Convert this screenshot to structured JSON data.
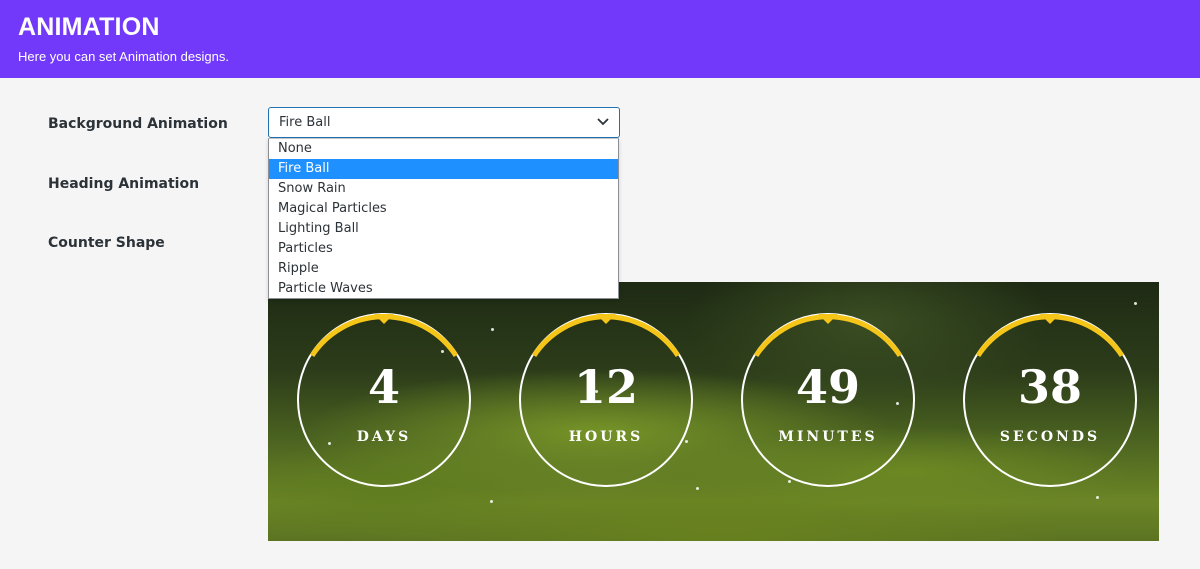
{
  "header": {
    "title": "ANIMATION",
    "subtitle": "Here you can set Animation designs."
  },
  "fields": {
    "background_animation_label": "Background Animation",
    "heading_animation_label": "Heading Animation",
    "counter_shape_label": "Counter Shape"
  },
  "select": {
    "value": "Fire Ball",
    "options": [
      "None",
      "Fire Ball",
      "Snow Rain",
      "Magical Particles",
      "Lighting Ball",
      "Particles",
      "Ripple",
      "Particle Waves"
    ],
    "selected_option": "Fire Ball"
  },
  "countdown": {
    "accent_color": "#f5c518",
    "items": [
      {
        "value": "4",
        "unit": "DAYS"
      },
      {
        "value": "12",
        "unit": "HOURS"
      },
      {
        "value": "49",
        "unit": "MINUTES"
      },
      {
        "value": "38",
        "unit": "SECONDS"
      }
    ]
  },
  "colors": {
    "header_bg": "#7239fb",
    "select_border": "#2271b1",
    "option_highlight": "#1e90ff"
  }
}
